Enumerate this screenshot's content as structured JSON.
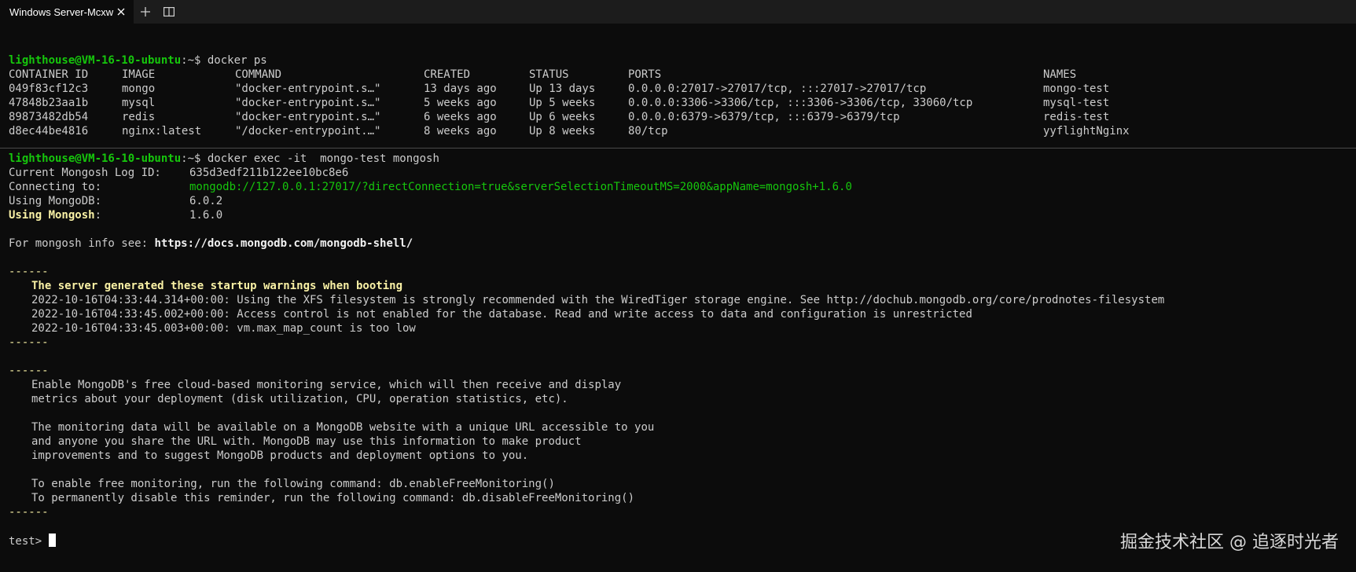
{
  "window": {
    "tab_title": "Windows Server-Mcxw",
    "tab_close_icon": "close-icon",
    "new_tab_icon": "plus-icon",
    "split_icon": "split-pane-icon"
  },
  "colors": {
    "background": "#0c0c0c",
    "prompt_green": "#16c60c",
    "yellow": "#f9f1a5",
    "text": "#cccccc"
  },
  "block1": {
    "prompt_user": "lighthouse@VM-16-10-ubuntu",
    "prompt_suffix": ":~$ ",
    "command": "docker ps",
    "headers": [
      "CONTAINER ID",
      "IMAGE",
      "COMMAND",
      "CREATED",
      "STATUS",
      "PORTS",
      "NAMES"
    ],
    "rows": [
      [
        "049f83cf12c3",
        "mongo",
        "\"docker-entrypoint.s…\"",
        "13 days ago",
        "Up 13 days",
        "0.0.0.0:27017->27017/tcp, :::27017->27017/tcp",
        "mongo-test"
      ],
      [
        "47848b23aa1b",
        "mysql",
        "\"docker-entrypoint.s…\"",
        "5 weeks ago",
        "Up 5 weeks",
        "0.0.0.0:3306->3306/tcp, :::3306->3306/tcp, 33060/tcp",
        "mysql-test"
      ],
      [
        "89873482db54",
        "redis",
        "\"docker-entrypoint.s…\"",
        "6 weeks ago",
        "Up 6 weeks",
        "0.0.0.0:6379->6379/tcp, :::6379->6379/tcp",
        "redis-test"
      ],
      [
        "d8ec44be4816",
        "nginx:latest",
        "\"/docker-entrypoint.…\"",
        "8 weeks ago",
        "Up 8 weeks",
        "80/tcp",
        "yyflightNginx"
      ]
    ]
  },
  "block2": {
    "prompt_user": "lighthouse@VM-16-10-ubuntu",
    "prompt_suffix": ":~$ ",
    "command": "docker exec -it  mongo-test mongosh",
    "log_id_key": "Current Mongosh Log ID:",
    "log_id_val": "635d3edf211b122ee10bc8e6",
    "connecting_key": "Connecting to:",
    "connecting_val": "mongodb://127.0.0.1:27017/?directConnection=true&serverSelectionTimeoutMS=2000&appName=mongosh+1.6.0",
    "mongodb_key": "Using MongoDB:",
    "mongodb_val": "6.0.2",
    "mongosh_key": "Using Mongosh",
    "mongosh_colon": ":",
    "mongosh_val": "1.6.0",
    "info_prefix": "For mongosh info see: ",
    "info_url": "https://docs.mongodb.com/mongodb-shell/",
    "sep": "------",
    "warn_title": "The server generated these startup warnings when booting",
    "warnings": [
      "2022-10-16T04:33:44.314+00:00: Using the XFS filesystem is strongly recommended with the WiredTiger storage engine. See http://dochub.mongodb.org/core/prodnotes-filesystem",
      "2022-10-16T04:33:45.002+00:00: Access control is not enabled for the database. Read and write access to data and configuration is unrestricted",
      "2022-10-16T04:33:45.003+00:00: vm.max_map_count is too low"
    ],
    "monitor_lines": [
      "Enable MongoDB's free cloud-based monitoring service, which will then receive and display",
      "metrics about your deployment (disk utilization, CPU, operation statistics, etc)."
    ],
    "monitor_lines2": [
      "The monitoring data will be available on a MongoDB website with a unique URL accessible to you",
      "and anyone you share the URL with. MongoDB may use this information to make product",
      "improvements and to suggest MongoDB products and deployment options to you."
    ],
    "enable_cmd": "To enable free monitoring, run the following command: db.enableFreeMonitoring()",
    "disable_cmd": "To permanently disable this reminder, run the following command: db.disableFreeMonitoring()",
    "final_prompt": "test> "
  },
  "watermark": "掘金技术社区 @ 追逐时光者"
}
